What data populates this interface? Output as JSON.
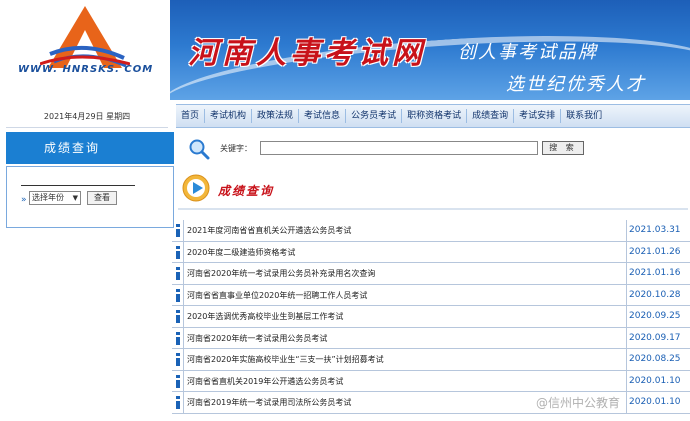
{
  "header": {
    "logo_url_text": "WWW. HNRSKS. COM",
    "site_title": "河南人事考试网",
    "slogan_line1": "创人事考试品牌",
    "slogan_line2": "选世纪优秀人才"
  },
  "sidebar": {
    "date": "2021年4月29日 星期四",
    "heading": "成绩查询",
    "year_select_value": "选择年份",
    "view_button": "查看"
  },
  "nav": {
    "items": [
      "首页",
      "考试机构",
      "政策法规",
      "考试信息",
      "公务员考试",
      "职称资格考试",
      "成绩查询",
      "考试安排",
      "联系我们"
    ]
  },
  "search": {
    "label": "关键字：",
    "button": "搜 索"
  },
  "section": {
    "title": "成绩查询"
  },
  "list": [
    {
      "title": "2021年度河南省省直机关公开遴选公务员考试",
      "date": "2021.03.31"
    },
    {
      "title": "2020年度二级建造师资格考试",
      "date": "2021.01.26"
    },
    {
      "title": "河南省2020年统一考试录用公务员补充录用名次查询",
      "date": "2021.01.16"
    },
    {
      "title": "河南省省直事业单位2020年统一招聘工作人员考试",
      "date": "2020.10.28"
    },
    {
      "title": "2020年选调优秀高校毕业生到基层工作考试",
      "date": "2020.09.25"
    },
    {
      "title": "河南省2020年统一考试录用公务员考试",
      "date": "2020.09.17"
    },
    {
      "title": "河南省2020年实施高校毕业生“三支一扶”计划招募考试",
      "date": "2020.08.25"
    },
    {
      "title": "河南省省直机关2019年公开遴选公务员考试",
      "date": "2020.01.10"
    },
    {
      "title": "河南省2019年统一考试录用司法所公务员考试",
      "date": "2020.01.10"
    }
  ],
  "watermark": "@信州中公教育",
  "colors": {
    "banner_blue": "#1d5fb8",
    "accent_blue": "#1b7fd2",
    "title_red": "#c8121a",
    "date_blue": "#1a5fb4"
  }
}
